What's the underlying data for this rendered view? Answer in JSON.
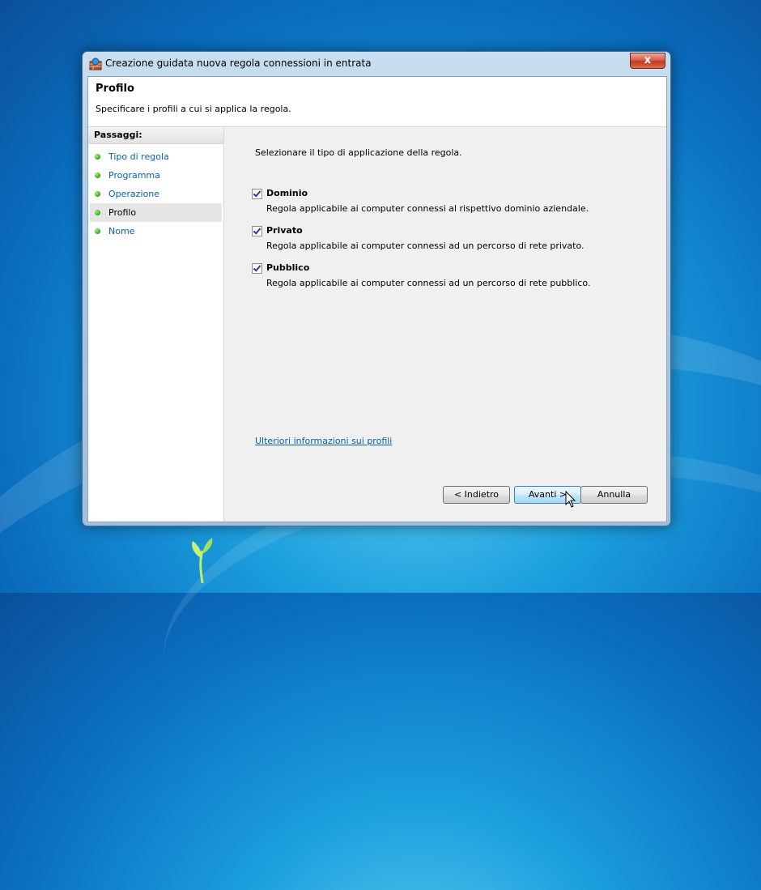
{
  "window": {
    "title": "Creazione guidata nuova regola connessioni in entrata",
    "close_label": "x"
  },
  "header": {
    "title": "Profilo",
    "subtitle": "Specificare i profili a cui si applica la regola."
  },
  "sidebar": {
    "header": "Passaggi:",
    "items": [
      {
        "label": "Tipo di regola"
      },
      {
        "label": "Programma"
      },
      {
        "label": "Operazione"
      },
      {
        "label": "Profilo"
      },
      {
        "label": "Nome"
      }
    ]
  },
  "main": {
    "instruction": "Selezionare il tipo di applicazione della regola.",
    "options": [
      {
        "label": "Dominio",
        "description": "Regola applicabile ai computer connessi al rispettivo dominio aziendale."
      },
      {
        "label": "Privato",
        "description": "Regola applicabile ai computer connessi ad un percorso di rete privato."
      },
      {
        "label": "Pubblico",
        "description": "Regola applicabile ai computer connessi ad un percorso di rete pubblico."
      }
    ],
    "link": "Ulteriori informazioni sui profili"
  },
  "buttons": {
    "back": "< Indietro",
    "next": "Avanti >",
    "cancel": "Annulla"
  }
}
